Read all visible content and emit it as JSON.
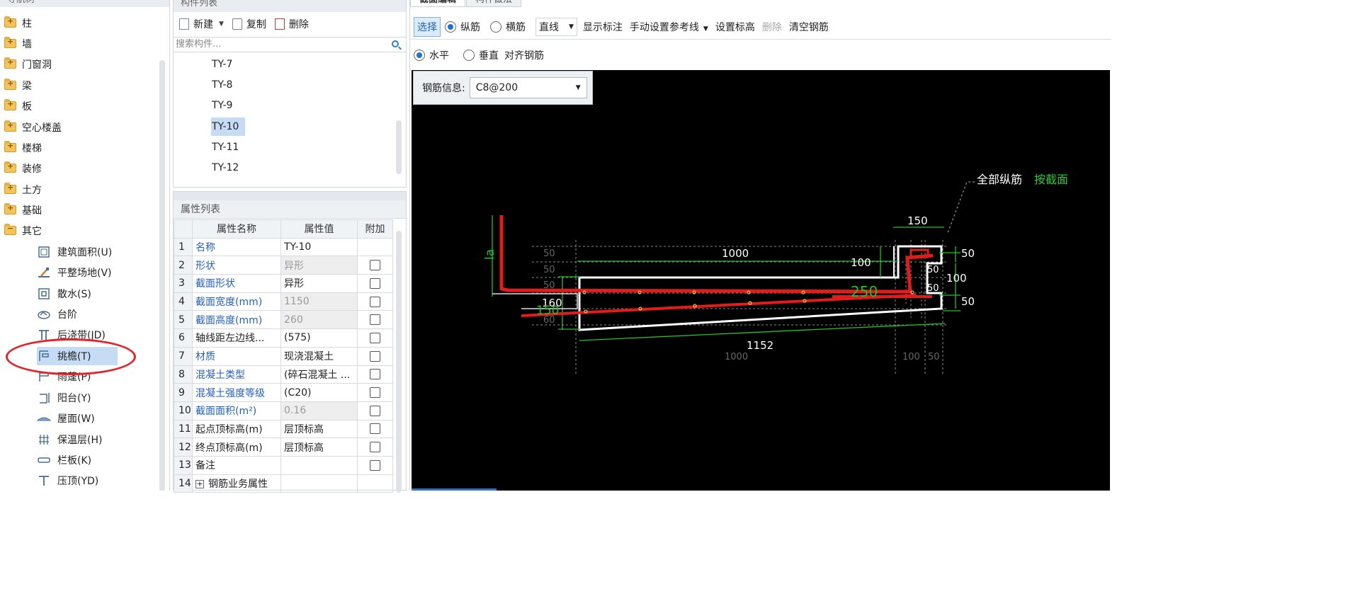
{
  "nav": {
    "header": "导航树",
    "items": [
      {
        "label": "柱",
        "icon": "folder-icon"
      },
      {
        "label": "墙",
        "icon": "folder-icon"
      },
      {
        "label": "门窗洞",
        "icon": "folder-icon"
      },
      {
        "label": "梁",
        "icon": "folder-icon"
      },
      {
        "label": "板",
        "icon": "folder-icon"
      },
      {
        "label": "空心楼盖",
        "icon": "folder-icon"
      },
      {
        "label": "楼梯",
        "icon": "folder-icon"
      },
      {
        "label": "装修",
        "icon": "folder-icon"
      },
      {
        "label": "土方",
        "icon": "folder-icon"
      },
      {
        "label": "基础",
        "icon": "folder-icon"
      },
      {
        "label": "其它",
        "icon": "folder-open-icon"
      }
    ],
    "children": [
      {
        "label": "建筑面积(U)",
        "icon": "building-area-icon"
      },
      {
        "label": "平整场地(V)",
        "icon": "site-leveling-icon"
      },
      {
        "label": "散水(S)",
        "icon": "apron-icon"
      },
      {
        "label": "台阶",
        "icon": "steps-icon"
      },
      {
        "label": "后浇带(JD)",
        "icon": "post-pour-strip-icon"
      },
      {
        "label": "挑檐(T)",
        "icon": "cornice-icon"
      },
      {
        "label": "雨蓬(P)",
        "icon": "canopy-icon"
      },
      {
        "label": "阳台(Y)",
        "icon": "balcony-icon"
      },
      {
        "label": "屋面(W)",
        "icon": "roof-icon"
      },
      {
        "label": "保温层(H)",
        "icon": "insulation-icon"
      },
      {
        "label": "栏板(K)",
        "icon": "parapet-icon"
      },
      {
        "label": "压顶(YD)",
        "icon": "coping-icon"
      }
    ],
    "selected_child": "挑檐(T)"
  },
  "component_list": {
    "header": "构件列表",
    "toolbar": {
      "new": "新建",
      "copy": "复制",
      "delete": "删除"
    },
    "search_placeholder": "搜索构件...",
    "items": [
      "TY-7",
      "TY-8",
      "TY-9",
      "TY-10",
      "TY-11",
      "TY-12"
    ],
    "selected": "TY-10"
  },
  "properties": {
    "header": "属性列表",
    "columns": [
      "属性名称",
      "属性值",
      "附加"
    ],
    "rows": [
      {
        "n": "1",
        "name": "名称",
        "value": "TY-10",
        "blue": true,
        "gray": false,
        "check": false
      },
      {
        "n": "2",
        "name": "形状",
        "value": "异形",
        "blue": true,
        "gray": true,
        "check": true
      },
      {
        "n": "3",
        "name": "截面形状",
        "value": "异形",
        "blue": true,
        "gray": false,
        "check": true
      },
      {
        "n": "4",
        "name": "截面宽度(mm)",
        "value": "1150",
        "blue": true,
        "gray": true,
        "check": true
      },
      {
        "n": "5",
        "name": "截面高度(mm)",
        "value": "260",
        "blue": true,
        "gray": true,
        "check": true
      },
      {
        "n": "6",
        "name": "轴线距左边线...",
        "value": "(575)",
        "blue": false,
        "gray": false,
        "check": true
      },
      {
        "n": "7",
        "name": "材质",
        "value": "现浇混凝土",
        "blue": true,
        "gray": false,
        "check": true
      },
      {
        "n": "8",
        "name": "混凝土类型",
        "value": "(碎石混凝土 ...",
        "blue": true,
        "gray": false,
        "check": true
      },
      {
        "n": "9",
        "name": "混凝土强度等级",
        "value": "(C20)",
        "blue": true,
        "gray": false,
        "check": true
      },
      {
        "n": "10",
        "name": "截面面积(m²)",
        "value": "0.16",
        "blue": true,
        "gray": true,
        "check": true
      },
      {
        "n": "11",
        "name": "起点顶标高(m)",
        "value": "层顶标高",
        "blue": false,
        "gray": false,
        "check": true
      },
      {
        "n": "12",
        "name": "终点顶标高(m)",
        "value": "层顶标高",
        "blue": false,
        "gray": false,
        "check": true
      },
      {
        "n": "13",
        "name": "备注",
        "value": "",
        "blue": false,
        "gray": false,
        "check": true
      },
      {
        "n": "14",
        "name": "钢筋业务属性",
        "value": "",
        "blue": false,
        "gray": false,
        "check": false,
        "expand": "+"
      }
    ]
  },
  "editor": {
    "tabs": [
      "截面编辑",
      "构件做法"
    ],
    "toolbar1": {
      "select": "选择",
      "longitudinal": "纵筋",
      "transverse": "横筋",
      "line_mode": "直线",
      "show_annotation": "显示标注",
      "manual_ref_line": "手动设置参考线",
      "set_elevation": "设置标高",
      "delete": "删除",
      "clear_rebar": "清空钢筋"
    },
    "toolbar2": {
      "horizontal": "水平",
      "vertical": "垂直",
      "align": "对齐钢筋"
    },
    "rebar_info_label": "钢筋信息:",
    "rebar_info_value": "C8@200",
    "drawing": {
      "note_white": "全部纵筋",
      "note_green": "按截面",
      "dims": {
        "top_150": "150",
        "top_1000": "1000",
        "left_50a": "50",
        "left_50b": "50",
        "left_50c": "50",
        "left_60": "60",
        "dim_100": "100",
        "dim_160": "160",
        "dim_150": "150",
        "right_50a": "50",
        "right_50b": "50",
        "right_100": "100",
        "right_50c": "50",
        "right_50d": "50",
        "inner_50a": "50",
        "inner_50b": "50",
        "bottom_1152": "1152",
        "bottom_1000": "1000",
        "bottom_100": "100",
        "bottom_50": "50",
        "red_250": "250",
        "la": "la"
      }
    }
  }
}
